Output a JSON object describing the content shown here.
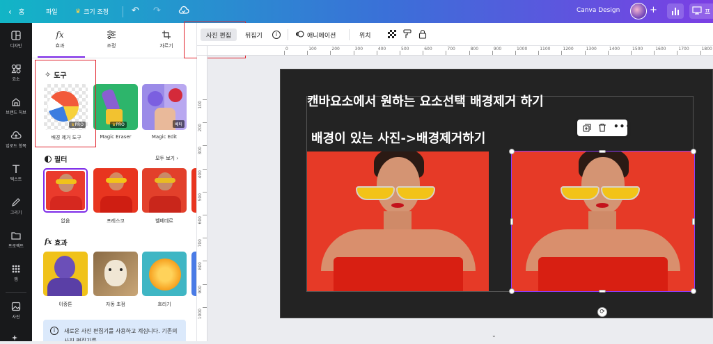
{
  "topbar": {
    "home": "홈",
    "file": "파일",
    "resize": "크기 조정",
    "design_title": "Canva Design",
    "share_partial": "프"
  },
  "rail": {
    "items": [
      {
        "label": "디자인",
        "icon": "template-icon"
      },
      {
        "label": "요소",
        "icon": "elements-icon"
      },
      {
        "label": "브랜드 허브",
        "icon": "brand-icon"
      },
      {
        "label": "업로드 항목",
        "icon": "upload-icon"
      },
      {
        "label": "텍스트",
        "icon": "text-icon"
      },
      {
        "label": "그리기",
        "icon": "draw-icon"
      },
      {
        "label": "프로젝트",
        "icon": "folder-icon"
      },
      {
        "label": "앱",
        "icon": "apps-icon"
      },
      {
        "label": "사진",
        "icon": "photo-icon"
      },
      {
        "label": "",
        "icon": "more-icon"
      }
    ]
  },
  "panel": {
    "tabs": [
      {
        "label": "효과",
        "icon": "fx-icon"
      },
      {
        "label": "조정",
        "icon": "sliders-icon"
      },
      {
        "label": "자르기",
        "icon": "crop-icon"
      }
    ],
    "tools_title": "도구",
    "tools": [
      {
        "label": "배경 제거 도구",
        "badge": "PRO"
      },
      {
        "label": "Magic Eraser",
        "badge": "PRO"
      },
      {
        "label": "Magic Edit",
        "badge": "베타"
      }
    ],
    "filters_title": "필터",
    "see_all": "모두 보기",
    "filters": [
      "없음",
      "프레스코",
      "벨베데르"
    ],
    "effects_title": "효과",
    "effects": [
      "이중톤",
      "자동 초점",
      "흐리기"
    ],
    "info_text": "새로운 사진 편집기를 사용하고 계십니다. 기존의 사진 편집기를"
  },
  "toolbar": {
    "edit_photo": "사진 편집",
    "flip_partial": "뒤집기",
    "animate": "애니메이션",
    "position": "위치"
  },
  "ruler": {
    "top": [
      "0",
      "100",
      "200",
      "300",
      "400",
      "500",
      "600",
      "700",
      "800",
      "900",
      "1000",
      "1100",
      "1200",
      "1300",
      "1400",
      "1500",
      "1600",
      "1700",
      "1800"
    ],
    "left": [
      "100",
      "200",
      "300",
      "400",
      "500",
      "600",
      "700",
      "800",
      "900",
      "1000"
    ]
  },
  "canvas": {
    "line1": "캔바요소에서 원하는 요소선택 배경제거 하기",
    "line2": "배경이 있는 사진->배경제거하기"
  }
}
